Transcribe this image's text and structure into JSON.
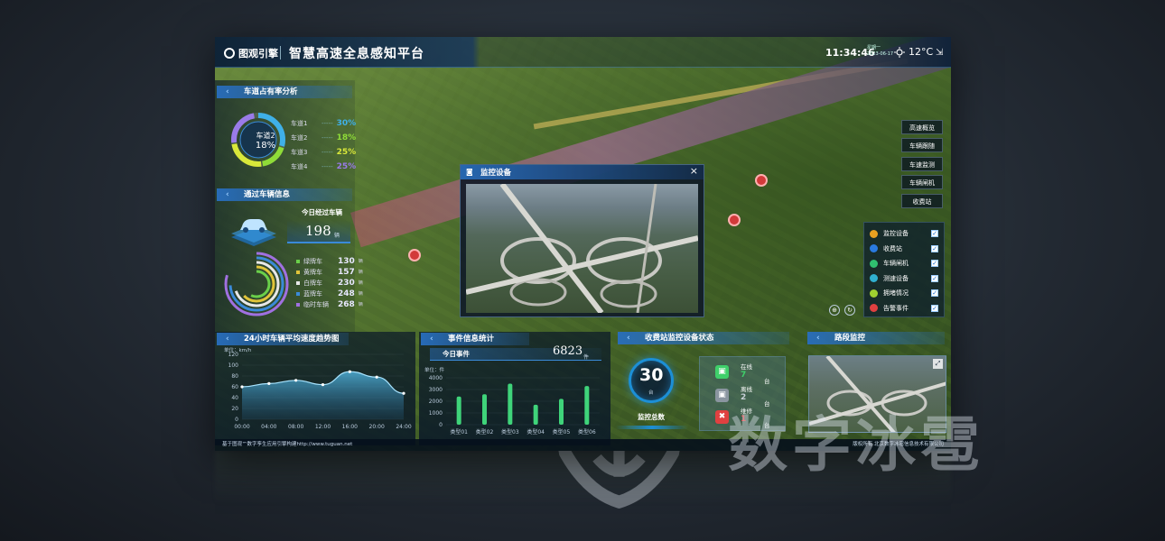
{
  "header": {
    "logo_text": "图观引擎",
    "title": "智慧高速全息感知平台",
    "time": "11:34:46",
    "weekday": "星期一",
    "date": "2023-06-17",
    "temperature": "12°C",
    "exit_icon": "exit-icon"
  },
  "lane_panel": {
    "title": "车道占有率分析",
    "center_label": "车道2",
    "center_value": "18%",
    "lanes": [
      {
        "name": "车道1",
        "value": "30%",
        "color": "#3fb0e8"
      },
      {
        "name": "车道2",
        "value": "18%",
        "color": "#8fdc38"
      },
      {
        "name": "车道3",
        "value": "25%",
        "color": "#d9e83a"
      },
      {
        "name": "车道4",
        "value": "25%",
        "color": "#9a7be8"
      }
    ]
  },
  "vehicle_panel": {
    "title": "通过车辆信息",
    "today_label": "今日经过车辆",
    "today_value": "198",
    "today_unit": "辆",
    "plates": [
      {
        "name": "绿牌车",
        "value": "130",
        "unit": "辆",
        "color": "#6ad04a"
      },
      {
        "name": "黄牌车",
        "value": "157",
        "unit": "辆",
        "color": "#e0c43a"
      },
      {
        "name": "白牌车",
        "value": "230",
        "unit": "辆",
        "color": "#e8e8e8"
      },
      {
        "name": "蓝牌车",
        "value": "248",
        "unit": "辆",
        "color": "#3a8ad8"
      },
      {
        "name": "临时车辆",
        "value": "268",
        "unit": "辆",
        "color": "#a070e0"
      }
    ]
  },
  "tools": [
    "高速概览",
    "车辆跟随",
    "车速监测",
    "车辆闸机",
    "收费站"
  ],
  "layers": [
    {
      "name": "监控设备",
      "color": "#e8a020",
      "checked": true
    },
    {
      "name": "收费站",
      "color": "#2a7ae0",
      "checked": true
    },
    {
      "name": "车辆闸机",
      "color": "#30c070",
      "checked": true
    },
    {
      "name": "测速设备",
      "color": "#30b0d0",
      "checked": true
    },
    {
      "name": "拥堵情况",
      "color": "#a0d030",
      "checked": true
    },
    {
      "name": "告警事件",
      "color": "#e04040",
      "checked": true
    }
  ],
  "popup": {
    "title": "监控设备",
    "close": "×"
  },
  "speed_panel": {
    "title": "24小时车辆平均速度趋势图",
    "unit": "单位：km/h",
    "yticks": [
      "120",
      "100",
      "80",
      "60",
      "40",
      "20",
      "0"
    ],
    "xticks": [
      "00:00",
      "04:00",
      "08:00",
      "12:00",
      "16:00",
      "20:00",
      "24:00"
    ]
  },
  "chart_data": [
    {
      "type": "area",
      "title": "24小时车辆平均速度趋势图",
      "ylabel": "单位：km/h",
      "x": [
        "00:00",
        "04:00",
        "08:00",
        "12:00",
        "16:00",
        "20:00",
        "24:00"
      ],
      "values": [
        60,
        66,
        72,
        64,
        88,
        78,
        48
      ],
      "ylim": [
        0,
        120
      ]
    },
    {
      "type": "bar",
      "title": "事件信息统计",
      "ylabel": "单位：件",
      "categories": [
        "类型01",
        "类型02",
        "类型03",
        "类型04",
        "类型05",
        "类型06"
      ],
      "values": [
        2400,
        2600,
        3500,
        1700,
        2200,
        3300
      ],
      "ylim": [
        0,
        4000
      ]
    }
  ],
  "event_panel": {
    "title": "事件信息统计",
    "today_label": "今日事件",
    "today_value": "6823",
    "today_unit": "件",
    "unit": "单位：件",
    "yticks": [
      "4000",
      "3000",
      "2000",
      "1000",
      "0"
    ]
  },
  "toll_panel": {
    "title": "收费站监控设备状态",
    "total_value": "30",
    "total_unit": "台",
    "total_label": "监控总数",
    "statuses": [
      {
        "label": "在线",
        "value": "7",
        "unit": "台",
        "color": "#3fcf6a"
      },
      {
        "label": "离线",
        "value": "2",
        "unit": "台",
        "color": "#c8d0d8"
      },
      {
        "label": "维修",
        "value": "1",
        "unit": "台",
        "color": "#e04040"
      }
    ]
  },
  "road_panel": {
    "title": "路段监控"
  },
  "footer": {
    "left": "基于图观™数字孪生应用引擎构建http://www.tuguan.net",
    "right": "版权所有 北京数字冰雹信息技术有限公司"
  },
  "watermark": "数字冰雹"
}
